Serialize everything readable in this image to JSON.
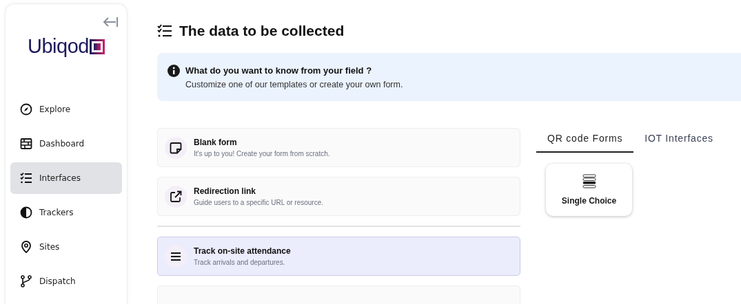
{
  "sidebar": {
    "logo": "Ubiqod",
    "items": [
      {
        "label": "Explore",
        "kind": "compass",
        "selected": false
      },
      {
        "label": "Dashboard",
        "kind": "grid",
        "selected": false
      },
      {
        "label": "Interfaces",
        "kind": "checklist",
        "selected": true
      },
      {
        "label": "Trackers",
        "kind": "halfcircle",
        "selected": false
      },
      {
        "label": "Sites",
        "kind": "pin",
        "selected": false
      },
      {
        "label": "Dispatch",
        "kind": "branch",
        "selected": false
      }
    ]
  },
  "page_title": "The data to be collected",
  "info": {
    "title": "What do you want to know from your field ?",
    "text": "Customize one of our templates or create your own form."
  },
  "templates": [
    {
      "title": "Blank form",
      "description": "It's up to you! Create your form from scratch.",
      "kind": "note",
      "selected": false
    },
    {
      "title": "Redirection link",
      "description": "Guide users to a specific URL or resource.",
      "kind": "external",
      "selected": false
    },
    {
      "kind": "divider"
    },
    {
      "title": "Track on-site attendance",
      "description": "Track arrivals and departures.",
      "kind": "menu",
      "selected": true
    }
  ],
  "tabs": [
    {
      "label": "QR code Forms",
      "selected": true
    },
    {
      "label": "IOT Interfaces",
      "selected": false
    }
  ],
  "form_types": [
    {
      "label": "Single Choice"
    }
  ]
}
